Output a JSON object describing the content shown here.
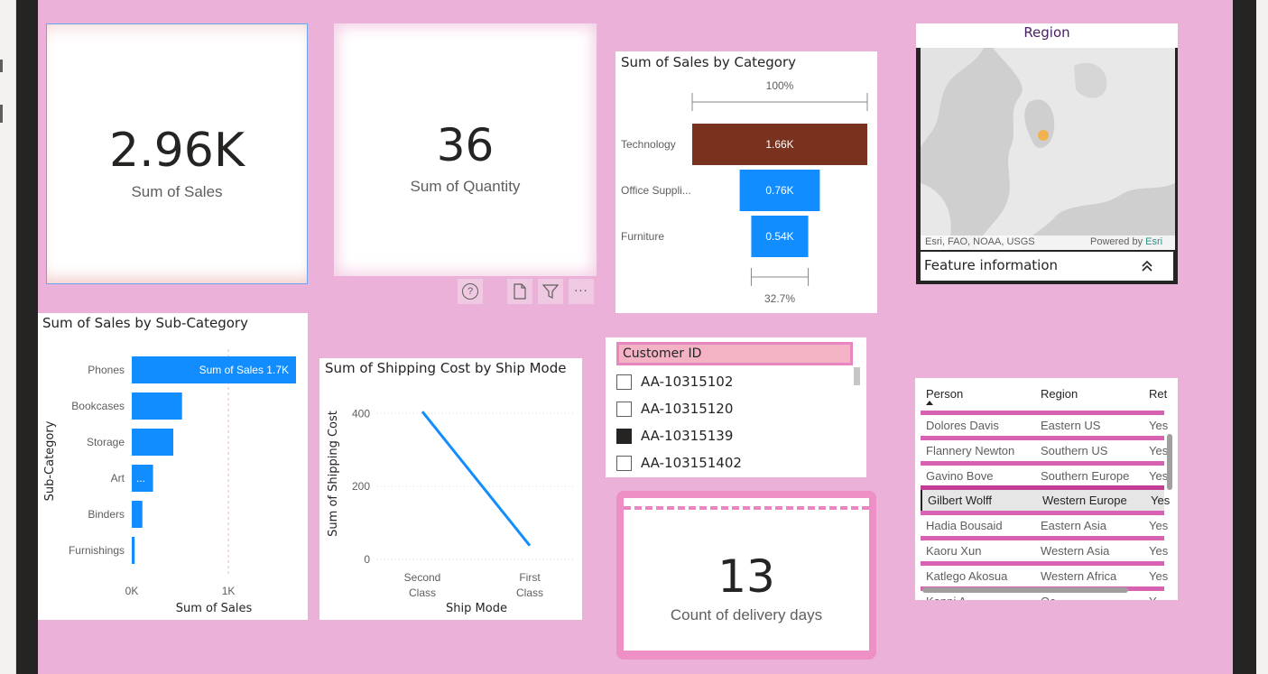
{
  "kpi_sales": {
    "value": "2.96K",
    "label": "Sum of Sales"
  },
  "kpi_quantity": {
    "value": "36",
    "label": "Sum of Quantity"
  },
  "kpi_delivery": {
    "value": "13",
    "label": "Count of delivery days"
  },
  "visual_toolbar": {
    "help": "?",
    "more": "···"
  },
  "funnel": {
    "title": "Sum of Sales by Category",
    "top_pct": "100%",
    "bottom_pct": "32.7%"
  },
  "map": {
    "title": "Region",
    "attribution": "Esri, FAO, NOAA, USGS",
    "powered_by": "Powered by",
    "powered_brand": "Esri",
    "feature_info": "Feature information",
    "marker_color": "#f2b24f"
  },
  "subcat_chart": {
    "title": "Sum of Sales by Sub-Category",
    "ylabel": "Sub-Category",
    "xlabel": "Sum of Sales",
    "xticks": [
      "0K",
      "1K"
    ],
    "phones_label": "Sum of Sales 1.7K",
    "art_label": "..."
  },
  "ship_chart": {
    "title": "Sum of Shipping Cost by Ship Mode",
    "ylabel": "Sum of Shipping Cost",
    "xlabel": "Ship Mode",
    "yticks": [
      "400",
      "200",
      "0"
    ],
    "xcats": [
      [
        "Second",
        "Class"
      ],
      [
        "First",
        "Class"
      ]
    ]
  },
  "customer_slicer": {
    "header": "Customer ID",
    "items": [
      {
        "id": "AA-10315102",
        "checked": false
      },
      {
        "id": "AA-10315120",
        "checked": false
      },
      {
        "id": "AA-10315139",
        "checked": true
      },
      {
        "id": "AA-103151402",
        "checked": false
      }
    ]
  },
  "people_table": {
    "columns": [
      "Person",
      "Region",
      "Ret"
    ],
    "rows": [
      {
        "person": "Dolores Davis",
        "region": "Eastern US",
        "ret": "Yes"
      },
      {
        "person": "Flannery Newton",
        "region": "Southern US",
        "ret": "Yes"
      },
      {
        "person": "Gavino Bove",
        "region": "Southern Europe",
        "ret": "Yes"
      },
      {
        "person": "Gilbert Wolff",
        "region": "Western Europe",
        "ret": "Yes"
      },
      {
        "person": "Hadia Bousaid",
        "region": "Eastern Asia",
        "ret": "Yes"
      },
      {
        "person": "Kaoru Xun",
        "region": "Western Asia",
        "ret": "Yes"
      },
      {
        "person": "Katlego Akosua",
        "region": "Western Africa",
        "ret": "Yes"
      },
      {
        "person": "Kanni A...",
        "region": "Oc...",
        "ret": "Y"
      }
    ]
  },
  "chart_data": [
    {
      "type": "bar",
      "title": "Sum of Sales by Category",
      "categories": [
        "Technology",
        "Office Suppli...",
        "Furniture"
      ],
      "values": [
        1.66,
        0.76,
        0.54
      ],
      "value_labels": [
        "1.66K",
        "0.76K",
        "0.54K"
      ],
      "colors": [
        "#78321e",
        "#118dff",
        "#118dff"
      ]
    },
    {
      "type": "bar",
      "title": "Sum of Sales by Sub-Category",
      "xlabel": "Sum of Sales",
      "ylabel": "Sub-Category",
      "categories": [
        "Phones",
        "Bookcases",
        "Storage",
        "Art",
        "Binders",
        "Furnishings"
      ],
      "values": [
        1.7,
        0.52,
        0.43,
        0.22,
        0.11,
        0.03
      ],
      "xlim": [
        0,
        1.7
      ],
      "color": "#118dff"
    },
    {
      "type": "line",
      "title": "Sum of Shipping Cost by Ship Mode",
      "xlabel": "Ship Mode",
      "ylabel": "Sum of Shipping Cost",
      "categories": [
        "Second Class",
        "First Class"
      ],
      "values": [
        405,
        38
      ],
      "ylim": [
        0,
        460
      ],
      "color": "#118dff"
    }
  ]
}
